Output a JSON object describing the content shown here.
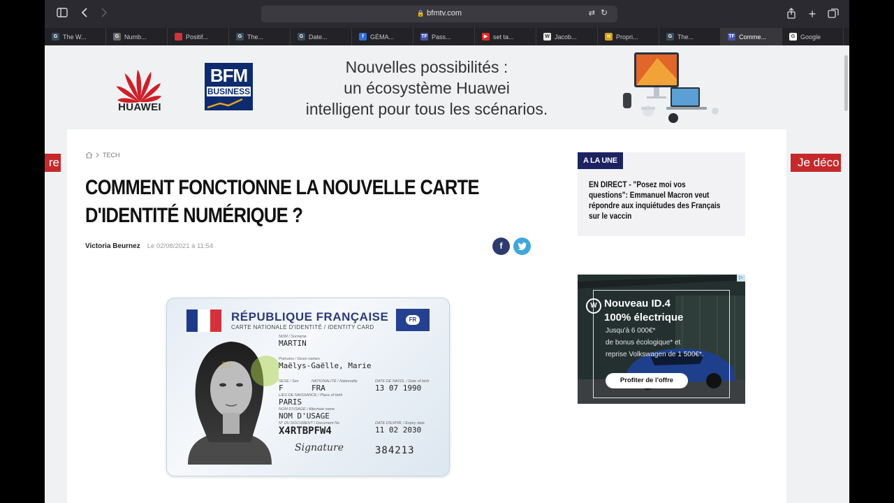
{
  "browser": {
    "url": "bfmtv.com",
    "tabs": [
      {
        "label": "The W...",
        "icon": "G",
        "color": "#3a4d5c"
      },
      {
        "label": "Numb...",
        "icon": "G",
        "color": "#6b6b6b"
      },
      {
        "label": "Positif...",
        "icon": "",
        "color": "#d0333b"
      },
      {
        "label": "The...",
        "icon": "G",
        "color": "#3a4d5c"
      },
      {
        "label": "Date...",
        "icon": "G",
        "color": "#3a4d5c"
      },
      {
        "label": "GÉMA...",
        "icon": "f",
        "color": "#2f6fd6"
      },
      {
        "label": "Pass...",
        "icon": "TF",
        "color": "#4452a8"
      },
      {
        "label": "set ta...",
        "icon": "▶",
        "color": "#e02727"
      },
      {
        "label": "Jacob...",
        "icon": "W",
        "color": "#e8e8e8"
      },
      {
        "label": "Propri...",
        "icon": "π",
        "color": "#d8a21b"
      },
      {
        "label": "The...",
        "icon": "G",
        "color": "#3a4d5c"
      },
      {
        "label": "Comme...",
        "icon": "TF",
        "color": "#4452a8",
        "active": true
      },
      {
        "label": "Google",
        "icon": "G",
        "color": "#ffffff"
      }
    ]
  },
  "banner": {
    "brand": "HUAWEI",
    "partner_top": "BFM",
    "partner_bottom": "BUSINESS",
    "line1": "Nouvelles possibilités :",
    "line2": "un écosystème Huawei",
    "line3": "intelligent pour tous les scénarios."
  },
  "side_tabs": {
    "left": "re",
    "right": "Je déco"
  },
  "article": {
    "breadcrumb": "TECH",
    "headline_line1": "COMMENT FONCTIONNE LA NOUVELLE CARTE",
    "headline_line2": "D'IDENTITÉ NUMÉRIQUE ?",
    "author": "Victoria Beurnez",
    "date": "Le 02/08/2021 à 11:54"
  },
  "id_card": {
    "title": "RÉPUBLIQUE FRANÇAISE",
    "subtitle": "CARTE NATIONALE D'IDENTITÉ / IDENTITY CARD",
    "eu_code": "FR",
    "nom_label": "NOM / Surname",
    "nom": "MARTIN",
    "prenoms_label": "Prénoms / Given names",
    "prenoms": "Maëlys-Gaëlle, Marie",
    "sexe_label": "SEXE / Sex",
    "sexe": "F",
    "nat_label": "NATIONALITÉ / Nationality",
    "nationalite": "FRA",
    "naiss_label": "DATE DE NAISS. / Date of birth",
    "naissance": "13 07 1990",
    "lieu_label": "LIEU DE NAISSANCE / Place of birth",
    "lieu": "PARIS",
    "usage_label": "NOM D'USAGE / Alternate name",
    "usage": "NOM D'USAGE",
    "doc_label": "N° DU DOCUMENT / Document No",
    "document": "X4RTBPFW4",
    "expir_label": "DATE D'EXPIR. / Expiry date",
    "expiration": "11 02 2030",
    "signature": "Signature",
    "number": "384213"
  },
  "sidebar": {
    "tag": "A LA UNE",
    "line1": "EN DIRECT - \"Posez moi vos",
    "line2": "questions\": Emmanuel Macron veut",
    "line3": "répondre aux inquiétudes des Français",
    "line4": "sur le vaccin"
  },
  "vw_ad": {
    "title1": "Nouveau ID.4",
    "title2": "100% électrique",
    "line1": "Jusqu'à 6 000€*",
    "line2": "de bonus écologique* et",
    "line3": "reprise Volkswagen de 1 500€*.",
    "cta": "Profiter de l'offre"
  }
}
